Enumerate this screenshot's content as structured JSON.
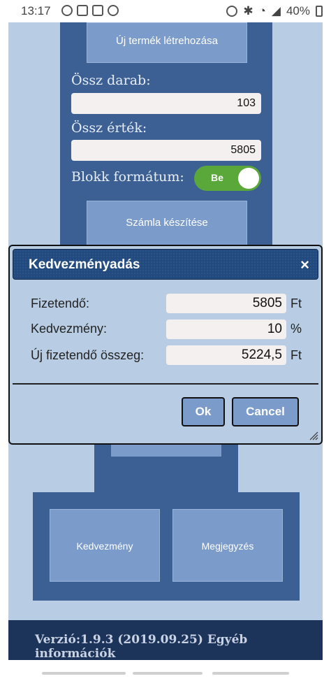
{
  "status_bar": {
    "time": "13:17",
    "battery": "40%",
    "left_icons": [
      "notification-icon",
      "image-icon",
      "clipboard-icon",
      "e-icon"
    ],
    "right_icons": [
      "alarm-icon",
      "bluetooth-icon",
      "wifi-icon",
      "signal-icon",
      "battery-icon"
    ]
  },
  "main": {
    "new_product_button": "Új termék létrehozása",
    "total_count_label": "Össz darab:",
    "total_count_value": "103",
    "total_value_label": "Össz érték:",
    "total_value_value": "5805",
    "block_format_label": "Blokk formátum:",
    "block_format_toggle": "Be",
    "create_invoice_button": "Számla készítése"
  },
  "bottom_panel": {
    "discount_button": "Kedvezmény",
    "note_button": "Megjegyzés"
  },
  "footer": {
    "text": "Verzió:1.9.3 (2019.09.25) Egyéb információk"
  },
  "dialog": {
    "title": "Kedvezményadás",
    "close_symbol": "×",
    "rows": [
      {
        "label": "Fizetendő:",
        "value": "5805",
        "unit": "Ft"
      },
      {
        "label": "Kedvezmény:",
        "value": "10",
        "unit": "%"
      },
      {
        "label": "Új fizetendő összeg:",
        "value": "5224,5",
        "unit": "Ft"
      }
    ],
    "ok_button": "Ok",
    "cancel_button": "Cancel"
  },
  "colors": {
    "app_background": "#b8cde4",
    "panel": "#3c5f94",
    "button": "#7b9bcb",
    "toggle_on": "#5aa73a",
    "dialog_title": "#234a7e",
    "footer": "#1d345a"
  }
}
